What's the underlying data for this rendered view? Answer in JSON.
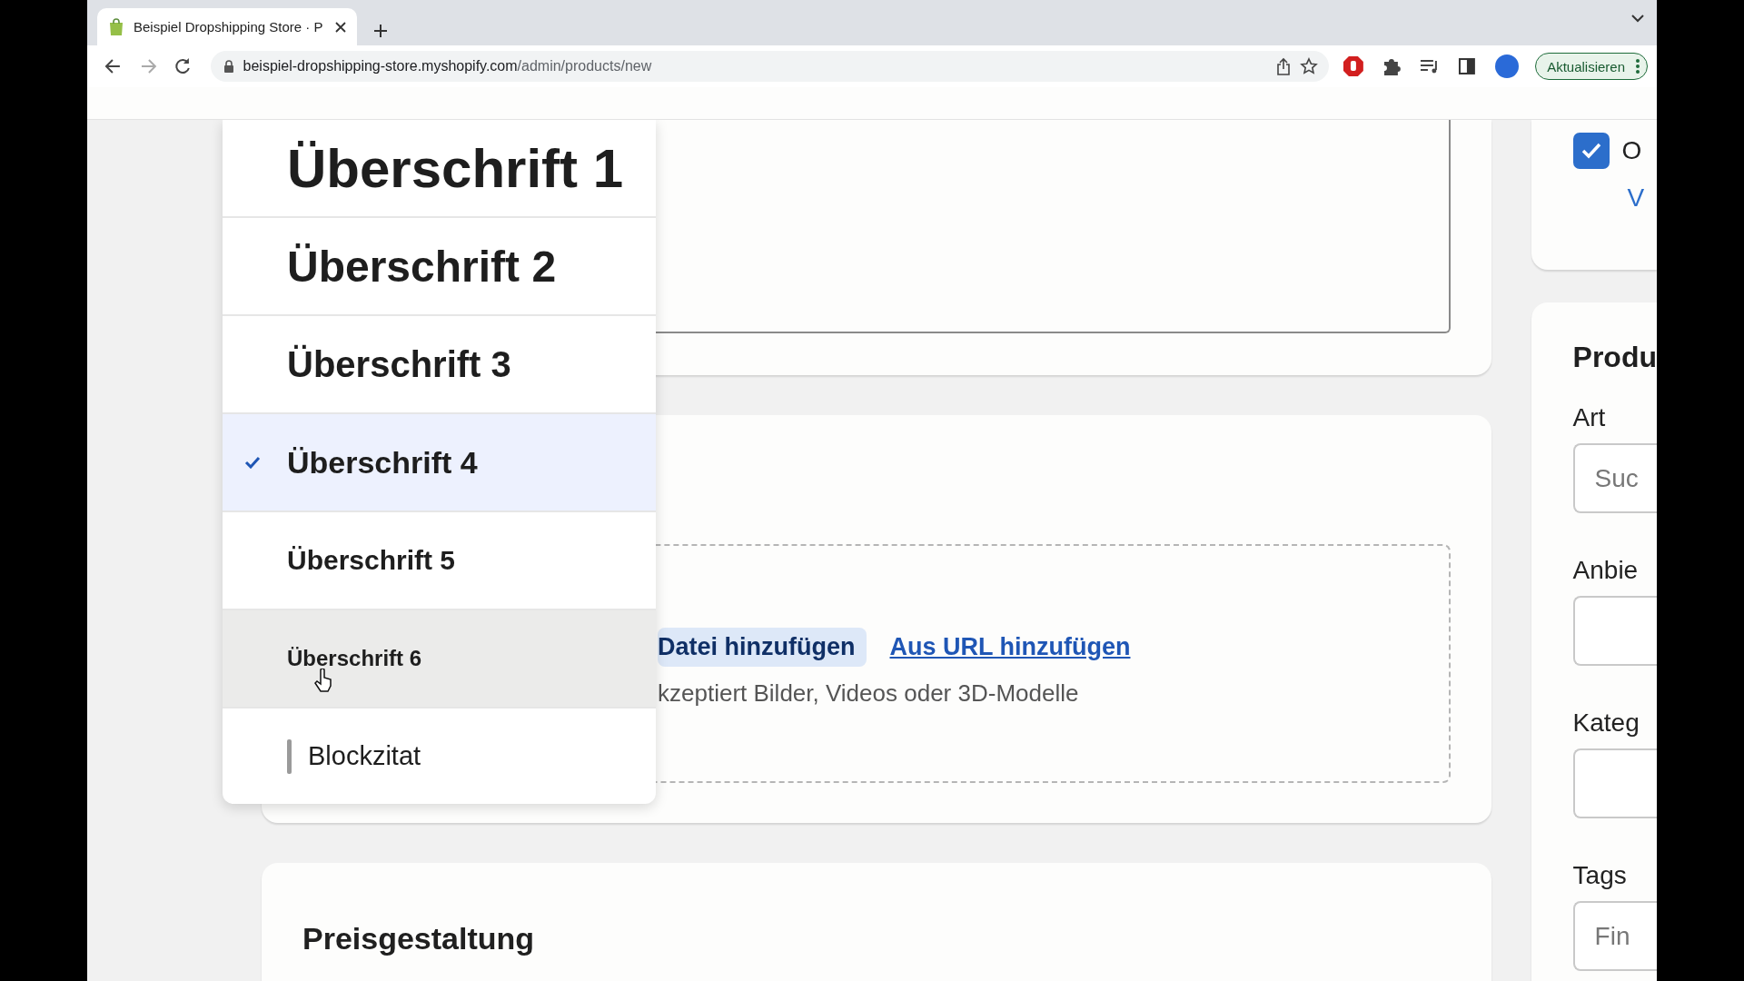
{
  "browser": {
    "tab_title": "Beispiel Dropshipping Store · P",
    "url_host": "beispiel-dropshipping-store.myshopify.com",
    "url_path": "/admin/products/new",
    "update_button": "Aktualisieren"
  },
  "format_menu": {
    "items": [
      {
        "label": "Überschrift 1",
        "kind": "h1",
        "selected": false,
        "hovered": false
      },
      {
        "label": "Überschrift 2",
        "kind": "h2",
        "selected": false,
        "hovered": false
      },
      {
        "label": "Überschrift 3",
        "kind": "h3",
        "selected": false,
        "hovered": false
      },
      {
        "label": "Überschrift 4",
        "kind": "h4",
        "selected": true,
        "hovered": false
      },
      {
        "label": "Überschrift 5",
        "kind": "h5",
        "selected": false,
        "hovered": false
      },
      {
        "label": "Überschrift 6",
        "kind": "h6",
        "selected": false,
        "hovered": true
      },
      {
        "label": "Blockzitat",
        "kind": "quote",
        "selected": false,
        "hovered": false
      }
    ]
  },
  "media": {
    "add_file_button": "Datei hinzufügen",
    "url_link": "Aus URL hinzufügen",
    "hint": "kzeptiert Bilder, Videos oder 3D-Modelle"
  },
  "pricing": {
    "title": "Preisgestaltung"
  },
  "sidebar": {
    "checkbox": {
      "label": "O",
      "checked": true
    },
    "link": "V",
    "product_card": {
      "title": "Produ",
      "fields": [
        {
          "label": "Art",
          "placeholder": "Suc"
        },
        {
          "label": "Anbie"
        },
        {
          "label": "Kateg"
        },
        {
          "label": "Tags",
          "placeholder": "Fin"
        }
      ]
    }
  }
}
